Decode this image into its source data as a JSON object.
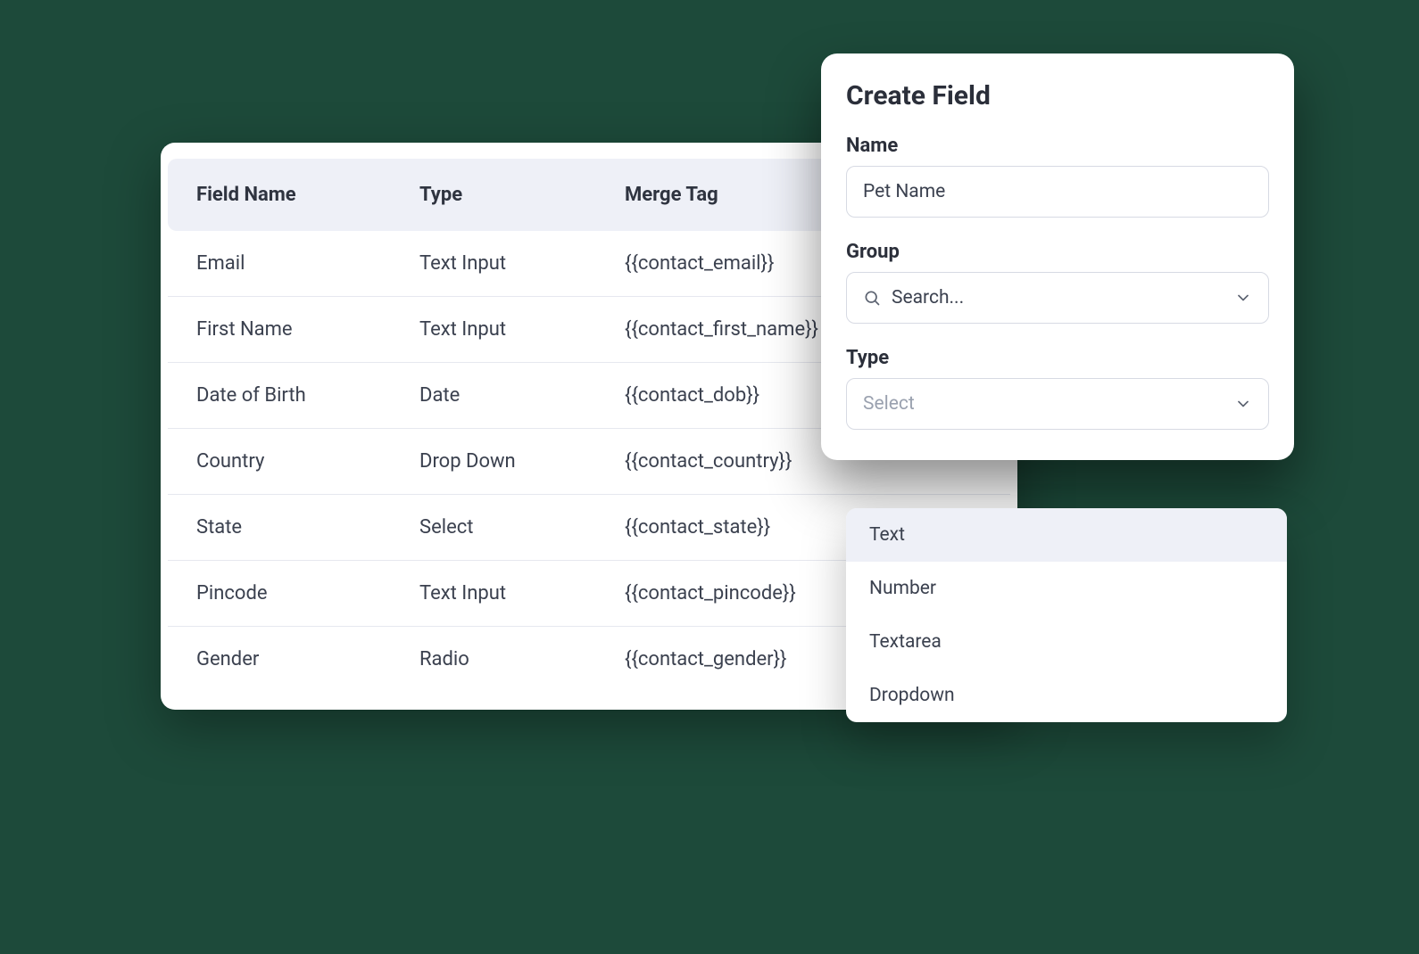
{
  "table": {
    "headers": {
      "field_name": "Field Name",
      "type": "Type",
      "merge_tag": "Merge Tag"
    },
    "rows": [
      {
        "field_name": "Email",
        "type": "Text Input",
        "merge_tag": "{{contact_email}}"
      },
      {
        "field_name": "First Name",
        "type": "Text Input",
        "merge_tag": "{{contact_first_name}}"
      },
      {
        "field_name": "Date of Birth",
        "type": "Date",
        "merge_tag": "{{contact_dob}}"
      },
      {
        "field_name": "Country",
        "type": "Drop Down",
        "merge_tag": "{{contact_country}}"
      },
      {
        "field_name": "State",
        "type": "Select",
        "merge_tag": "{{contact_state}}"
      },
      {
        "field_name": "Pincode",
        "type": "Text Input",
        "merge_tag": "{{contact_pincode}}"
      },
      {
        "field_name": "Gender",
        "type": "Radio",
        "merge_tag": "{{contact_gender}}"
      }
    ]
  },
  "panel": {
    "title": "Create Field",
    "name_label": "Name",
    "name_value": "Pet Name",
    "group_label": "Group",
    "group_placeholder": "Search...",
    "type_label": "Type",
    "type_placeholder": "Select",
    "type_options": [
      {
        "label": "Text",
        "highlighted": true
      },
      {
        "label": "Number",
        "highlighted": false
      },
      {
        "label": "Textarea",
        "highlighted": false
      },
      {
        "label": "Dropdown",
        "highlighted": false
      }
    ]
  },
  "colors": {
    "background": "#1d4a3a",
    "card_bg": "#ffffff",
    "header_bg": "#eef0f7",
    "text": "#3b414f",
    "muted": "#9aa1af",
    "border": "#d7dae3"
  }
}
